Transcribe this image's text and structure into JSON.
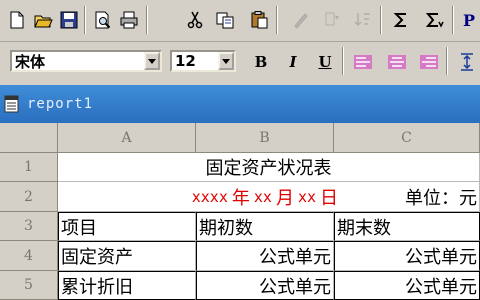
{
  "toolbar": {
    "buttons": [
      {
        "name": "new-document-icon"
      },
      {
        "name": "open-folder-icon"
      },
      {
        "name": "save-icon"
      },
      {
        "name": "print-preview-icon"
      },
      {
        "name": "print-icon"
      },
      {
        "name": "cut-icon"
      },
      {
        "name": "copy-icon"
      },
      {
        "name": "paste-icon"
      },
      {
        "name": "format-painter-icon"
      },
      {
        "name": "filter-icon"
      },
      {
        "name": "sort-icon"
      },
      {
        "name": "sum-icon"
      },
      {
        "name": "function-icon"
      }
    ],
    "last_button_text": "P"
  },
  "format_bar": {
    "font_name": "宋体",
    "font_size": "12",
    "bold_label": "B",
    "italic_label": "I",
    "underline_label": "U"
  },
  "document": {
    "title": "report1"
  },
  "grid": {
    "columns": [
      "A",
      "B",
      "C"
    ],
    "row_numbers": [
      "1",
      "2",
      "3",
      "4",
      "5"
    ],
    "title": "固定资产状况表",
    "date_line": {
      "part1": "xxxx",
      "part2": "年",
      "part3": "xx",
      "part4": "月",
      "part5": "xx",
      "part6": "日"
    },
    "unit_label": "单位：元",
    "headers": [
      "项目",
      "期初数",
      "期末数"
    ],
    "rows": [
      {
        "item": "固定资产",
        "begin": "公式单元",
        "end": "公式单元"
      },
      {
        "item": "累计折旧",
        "begin": "公式单元",
        "end": "公式单元"
      }
    ]
  },
  "colors": {
    "accent_red": "#e00000",
    "title_bar": "#2a6fc0",
    "toolbar_bg": "#d4d0c8"
  }
}
